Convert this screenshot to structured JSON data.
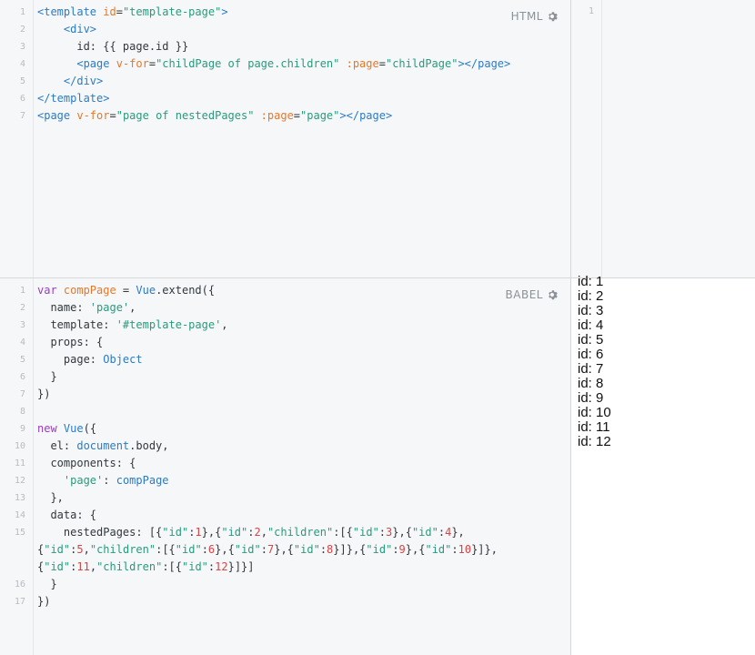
{
  "html_pane": {
    "label": "HTML",
    "lines": [
      {
        "n": "1",
        "segments": [
          [
            "tag",
            "<template "
          ],
          [
            "attr",
            "id"
          ],
          [
            "plain",
            "="
          ],
          [
            "str",
            "\"template-page\""
          ],
          [
            "tag",
            ">"
          ]
        ]
      },
      {
        "n": "2",
        "segments": [
          [
            "plain",
            "    "
          ],
          [
            "tag",
            "<div>"
          ]
        ]
      },
      {
        "n": "3",
        "segments": [
          [
            "plain",
            "      id: {{ page.id }}"
          ]
        ]
      },
      {
        "n": "4",
        "segments": [
          [
            "plain",
            "      "
          ],
          [
            "tag",
            "<page "
          ],
          [
            "attr",
            "v-for"
          ],
          [
            "plain",
            "="
          ],
          [
            "str",
            "\"childPage of page.children\""
          ],
          [
            "plain",
            " "
          ],
          [
            "attr",
            ":page"
          ],
          [
            "plain",
            "="
          ],
          [
            "str",
            "\"childPage\""
          ],
          [
            "tag",
            "></page>"
          ]
        ]
      },
      {
        "n": "5",
        "segments": [
          [
            "plain",
            "    "
          ],
          [
            "tag",
            "</div>"
          ]
        ]
      },
      {
        "n": "6",
        "segments": [
          [
            "tag",
            "</template>"
          ]
        ]
      },
      {
        "n": "7",
        "segments": [
          [
            "tag",
            "<page "
          ],
          [
            "attr",
            "v-for"
          ],
          [
            "plain",
            "="
          ],
          [
            "str",
            "\"page of nestedPages\""
          ],
          [
            "plain",
            " "
          ],
          [
            "attr",
            ":page"
          ],
          [
            "plain",
            "="
          ],
          [
            "str",
            "\"page\""
          ],
          [
            "tag",
            "></page>"
          ]
        ]
      }
    ]
  },
  "babel_pane": {
    "label": "BABEL",
    "lines": [
      {
        "n": "1",
        "segments": [
          [
            "kw",
            "var "
          ],
          [
            "var",
            "compPage"
          ],
          [
            "plain",
            " = "
          ],
          [
            "fn",
            "Vue"
          ],
          [
            "plain",
            ".extend({"
          ]
        ]
      },
      {
        "n": "2",
        "segments": [
          [
            "plain",
            "  name: "
          ],
          [
            "str",
            "'page'"
          ],
          [
            "plain",
            ","
          ]
        ]
      },
      {
        "n": "3",
        "segments": [
          [
            "plain",
            "  template: "
          ],
          [
            "str",
            "'#template-page'"
          ],
          [
            "plain",
            ","
          ]
        ]
      },
      {
        "n": "4",
        "segments": [
          [
            "plain",
            "  props: {"
          ]
        ]
      },
      {
        "n": "5",
        "segments": [
          [
            "plain",
            "    page: "
          ],
          [
            "fn",
            "Object"
          ]
        ]
      },
      {
        "n": "6",
        "segments": [
          [
            "plain",
            "  }"
          ]
        ]
      },
      {
        "n": "7",
        "segments": [
          [
            "plain",
            "})"
          ]
        ]
      },
      {
        "n": "8",
        "segments": [
          [
            "plain",
            ""
          ]
        ]
      },
      {
        "n": "9",
        "segments": [
          [
            "kw",
            "new "
          ],
          [
            "fn",
            "Vue"
          ],
          [
            "plain",
            "({"
          ]
        ]
      },
      {
        "n": "10",
        "segments": [
          [
            "plain",
            "  el: "
          ],
          [
            "fn",
            "document"
          ],
          [
            "plain",
            ".body,"
          ]
        ]
      },
      {
        "n": "11",
        "segments": [
          [
            "plain",
            "  components: {"
          ]
        ]
      },
      {
        "n": "12",
        "segments": [
          [
            "plain",
            "    "
          ],
          [
            "str",
            "'page'"
          ],
          [
            "plain",
            ": "
          ],
          [
            "fn",
            "compPage"
          ]
        ]
      },
      {
        "n": "13",
        "segments": [
          [
            "plain",
            "  },"
          ]
        ]
      },
      {
        "n": "14",
        "segments": [
          [
            "plain",
            "  data: {"
          ]
        ]
      },
      {
        "n": "15",
        "segments": [
          [
            "plain",
            "    nestedPages: [{"
          ],
          [
            "str",
            "\"id\""
          ],
          [
            "plain",
            ":"
          ],
          [
            "num",
            "1"
          ],
          [
            "plain",
            "},{"
          ],
          [
            "str",
            "\"id\""
          ],
          [
            "plain",
            ":"
          ],
          [
            "num",
            "2"
          ],
          [
            "plain",
            ","
          ],
          [
            "str",
            "\"children\""
          ],
          [
            "plain",
            ":[{"
          ],
          [
            "str",
            "\"id\""
          ],
          [
            "plain",
            ":"
          ],
          [
            "num",
            "3"
          ],
          [
            "plain",
            "},{"
          ],
          [
            "str",
            "\"id\""
          ],
          [
            "plain",
            ":"
          ],
          [
            "num",
            "4"
          ],
          [
            "plain",
            "},"
          ]
        ]
      },
      {
        "n": "",
        "segments": [
          [
            "plain",
            "{"
          ],
          [
            "str",
            "\"id\""
          ],
          [
            "plain",
            ":"
          ],
          [
            "num",
            "5"
          ],
          [
            "plain",
            ","
          ],
          [
            "str",
            "\"children\""
          ],
          [
            "plain",
            ":[{"
          ],
          [
            "str",
            "\"id\""
          ],
          [
            "plain",
            ":"
          ],
          [
            "num",
            "6"
          ],
          [
            "plain",
            "},{"
          ],
          [
            "str",
            "\"id\""
          ],
          [
            "plain",
            ":"
          ],
          [
            "num",
            "7"
          ],
          [
            "plain",
            "},{"
          ],
          [
            "str",
            "\"id\""
          ],
          [
            "plain",
            ":"
          ],
          [
            "num",
            "8"
          ],
          [
            "plain",
            "}]},{"
          ],
          [
            "str",
            "\"id\""
          ],
          [
            "plain",
            ":"
          ],
          [
            "num",
            "9"
          ],
          [
            "plain",
            "},{"
          ],
          [
            "str",
            "\"id\""
          ],
          [
            "plain",
            ":"
          ],
          [
            "num",
            "10"
          ],
          [
            "plain",
            "}]},"
          ]
        ]
      },
      {
        "n": "",
        "segments": [
          [
            "plain",
            "{"
          ],
          [
            "str",
            "\"id\""
          ],
          [
            "plain",
            ":"
          ],
          [
            "num",
            "11"
          ],
          [
            "plain",
            ","
          ],
          [
            "str",
            "\"children\""
          ],
          [
            "plain",
            ":[{"
          ],
          [
            "str",
            "\"id\""
          ],
          [
            "plain",
            ":"
          ],
          [
            "num",
            "12"
          ],
          [
            "plain",
            "}]}]"
          ]
        ]
      },
      {
        "n": "16",
        "segments": [
          [
            "plain",
            "  }"
          ]
        ]
      },
      {
        "n": "17",
        "segments": [
          [
            "plain",
            "})"
          ]
        ]
      }
    ]
  },
  "result_pane": {
    "gutter_number": "1"
  },
  "output": {
    "items": [
      "id: 1",
      "id: 2",
      "id: 3",
      "id: 4",
      "id: 5",
      "id: 6",
      "id: 7",
      "id: 8",
      "id: 9",
      "id: 10",
      "id: 11",
      "id: 12"
    ]
  }
}
